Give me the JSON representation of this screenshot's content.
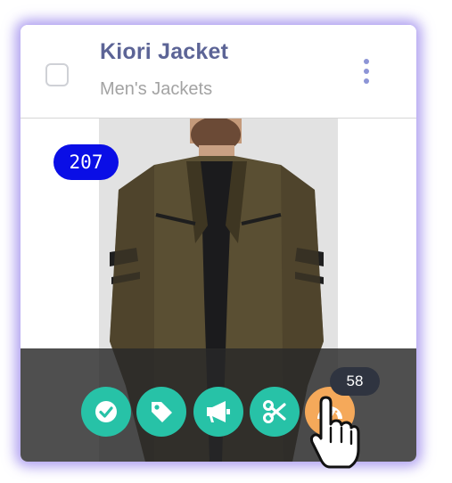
{
  "product": {
    "title": "Kiori Jacket",
    "category": "Men's Jackets",
    "count_badge": "207"
  },
  "actions": [
    {
      "icon": "check-circle-icon",
      "color": "#27c2a7"
    },
    {
      "icon": "tag-icon",
      "color": "#27c2a7"
    },
    {
      "icon": "megaphone-icon",
      "color": "#27c2a7"
    },
    {
      "icon": "scissors-icon",
      "color": "#27c2a7"
    },
    {
      "icon": "speedometer-icon",
      "color": "#f5a95a",
      "tooltip": "58"
    }
  ],
  "colors": {
    "title": "#5c6496",
    "badge": "#0a0ee6",
    "accent": "#27c2a7",
    "highlight": "#f5a95a"
  }
}
